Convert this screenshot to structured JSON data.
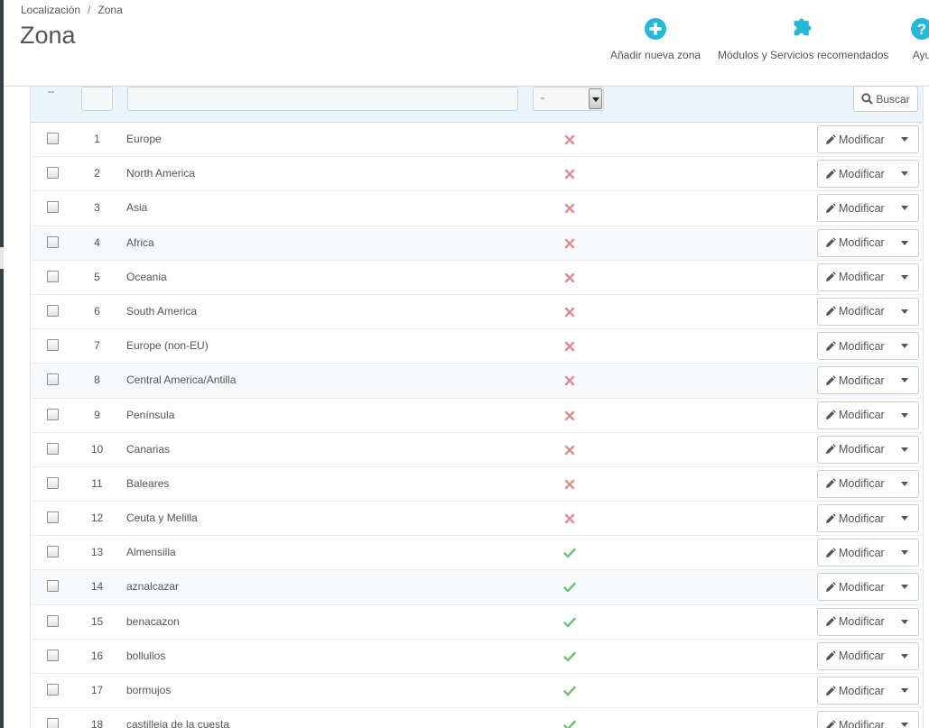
{
  "breadcrumb": {
    "parent": "Localización",
    "separator": "/",
    "current": "Zona"
  },
  "page": {
    "title": "Zona"
  },
  "toolbar": {
    "add_label": "Añadir nueva zona",
    "modules_label": "Módulos y Servicios recomendados",
    "help_label": "Ayu"
  },
  "filters": {
    "bulk_placeholder": "--",
    "active_select_value": "-",
    "search_label": "Buscar"
  },
  "actions": {
    "edit_label": "Modificar"
  },
  "colors": {
    "accent": "#25b9d7",
    "disabled": "#e08f95",
    "enabled": "#72c279"
  },
  "rows": [
    {
      "id": "1",
      "name": "Europe",
      "active": false
    },
    {
      "id": "2",
      "name": "North America",
      "active": false
    },
    {
      "id": "3",
      "name": "Asia",
      "active": false
    },
    {
      "id": "4",
      "name": "Africa",
      "active": false
    },
    {
      "id": "5",
      "name": "Oceania",
      "active": false
    },
    {
      "id": "6",
      "name": "South America",
      "active": false
    },
    {
      "id": "7",
      "name": "Europe (non-EU)",
      "active": false
    },
    {
      "id": "8",
      "name": "Central America/Antilla",
      "active": false
    },
    {
      "id": "9",
      "name": "Península",
      "active": false
    },
    {
      "id": "10",
      "name": "Canarias",
      "active": false
    },
    {
      "id": "11",
      "name": "Baleares",
      "active": false
    },
    {
      "id": "12",
      "name": "Ceuta y Melilla",
      "active": false
    },
    {
      "id": "13",
      "name": "Almensilla",
      "active": true
    },
    {
      "id": "14",
      "name": "aznalcazar",
      "active": true
    },
    {
      "id": "15",
      "name": "benacazon",
      "active": true
    },
    {
      "id": "16",
      "name": "bollullos",
      "active": true
    },
    {
      "id": "17",
      "name": "bormujos",
      "active": true
    },
    {
      "id": "18",
      "name": "castilleja de la cuesta",
      "active": true
    }
  ]
}
